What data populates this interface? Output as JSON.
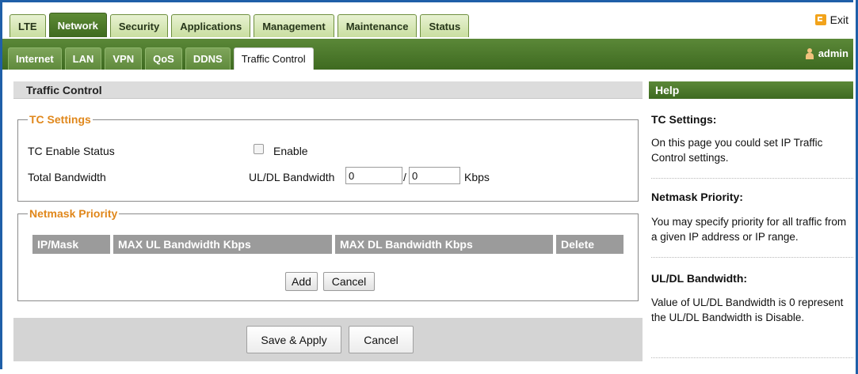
{
  "top_tabs": [
    "LTE",
    "Network",
    "Security",
    "Applications",
    "Management",
    "Maintenance",
    "Status"
  ],
  "top_active": "Network",
  "exit_label": "Exit",
  "sub_tabs": [
    "Internet",
    "LAN",
    "VPN",
    "QoS",
    "DDNS",
    "Traffic Control"
  ],
  "sub_active": "Traffic Control",
  "user_label": "admin",
  "page_title": "Traffic Control",
  "tc": {
    "legend": "TC Settings",
    "enable_status_label": "TC Enable Status",
    "enable_checkbox_label": "Enable",
    "enable_checked": false,
    "bandwidth_label": "Total Bandwidth",
    "uldl_label": "UL/DL Bandwidth",
    "ul_value": "0",
    "separator": "/",
    "dl_value": "0",
    "unit": "Kbps"
  },
  "netmask": {
    "legend": "Netmask Priority",
    "columns": [
      "IP/Mask",
      "MAX UL Bandwidth Kbps",
      "MAX DL Bandwidth Kbps",
      "Delete"
    ],
    "add_label": "Add",
    "cancel_label": "Cancel"
  },
  "actions": {
    "save_label": "Save & Apply",
    "cancel_label": "Cancel"
  },
  "help": {
    "title": "Help",
    "sections": [
      {
        "heading": "TC Settings:",
        "text": "On this page you could set IP Traffic Control settings."
      },
      {
        "heading": "Netmask Priority:",
        "text": "You may specify priority for all traffic from a given IP address or IP range."
      },
      {
        "heading": "UL/DL Bandwidth:",
        "text": "Value of UL/DL Bandwidth is 0 represent the UL/DL Bandwidth is Disable."
      }
    ]
  },
  "colors": {
    "accent_green": "#4a7a2a",
    "legend_orange": "#e0871b",
    "frame_blue": "#1f5fa8"
  },
  "icons": {
    "exit": "exit-icon",
    "user": "user-icon"
  }
}
